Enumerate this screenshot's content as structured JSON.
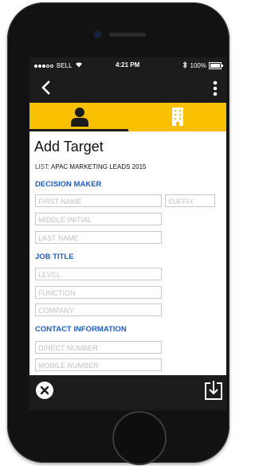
{
  "status": {
    "carrier": "BELL",
    "time": "4:21 PM",
    "battery": "100%",
    "battery_level": 1.0
  },
  "nav": {
    "back_icon": "chevron-left-icon",
    "menu_icon": "vertical-dots-icon"
  },
  "tabs": [
    {
      "icon": "person-icon",
      "selected": true
    },
    {
      "icon": "building-icon",
      "selected": false
    }
  ],
  "form": {
    "title": "Add Target",
    "list_label": "LIST:",
    "list_value": "APAC MARKETING LEADS 2015",
    "sections": {
      "decision_maker": "DECISION MAKER",
      "job_title": "JOB TITLE",
      "contact_info": "CONTACT INFORMATION"
    },
    "fields": {
      "first_name": "FIRST NAME",
      "suffix": "SUFFIX",
      "middle_initial": "MIDDLE INITIAL",
      "last_name": "LAST NAME",
      "level": "LEVEL",
      "function": "FUNCTION",
      "company": "COMPANY",
      "direct_number": "DIRECT NUMBER",
      "mobile_number": "MOBILE NUMBER"
    }
  },
  "bottom": {
    "close_icon": "close-icon",
    "save_icon": "save-download-icon"
  },
  "colors": {
    "accent": "#f8c000",
    "section_blue": "#1f5fbf",
    "bar_dark": "#1c1c1c"
  }
}
